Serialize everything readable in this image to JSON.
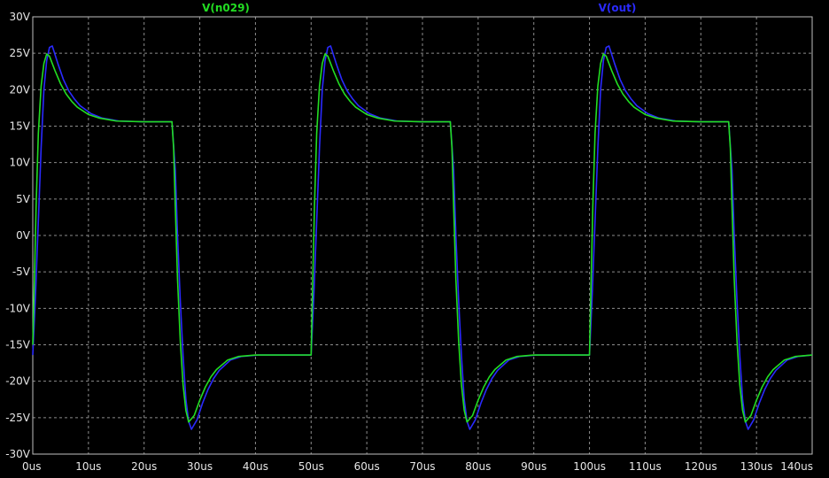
{
  "chart_data": {
    "type": "line",
    "title": "",
    "xlabel": "",
    "ylabel": "",
    "xlim": [
      0,
      140
    ],
    "ylim": [
      -30,
      30
    ],
    "grid": true,
    "legend_placement": "top",
    "x_ticks": [
      0,
      10,
      20,
      30,
      40,
      50,
      60,
      70,
      80,
      90,
      100,
      110,
      120,
      130,
      140
    ],
    "x_tick_labels": [
      "0us",
      "10us",
      "20us",
      "30us",
      "40us",
      "50us",
      "60us",
      "70us",
      "80us",
      "90us",
      "100us",
      "110us",
      "120us",
      "130us",
      "140us"
    ],
    "y_ticks": [
      -30,
      -25,
      -20,
      -15,
      -10,
      -5,
      0,
      5,
      10,
      15,
      20,
      25,
      30
    ],
    "y_tick_labels": [
      "-30V",
      "-25V",
      "-20V",
      "-15V",
      "-10V",
      "-5V",
      "0V",
      "5V",
      "10V",
      "15V",
      "20V",
      "25V",
      "30V"
    ],
    "colors": {
      "background": "#000000",
      "grid": "#8c8c8c",
      "axis": "#bfbfbf",
      "tick_text": "#e6e6e6"
    },
    "series": [
      {
        "name": "V(n029)",
        "color": "#22dd22",
        "x": [
          0,
          0.3,
          0.6,
          1,
          1.5,
          2,
          2.5,
          3,
          4,
          5,
          6,
          7,
          8,
          10,
          12,
          15,
          20,
          25,
          25.3,
          25.6,
          26,
          26.5,
          27,
          27.5,
          28,
          29,
          30,
          31,
          32,
          33,
          35,
          37,
          40,
          45,
          50,
          50.3,
          50.6,
          51,
          51.5,
          52,
          52.5,
          53,
          54,
          55,
          56,
          57,
          58,
          60,
          62,
          65,
          70,
          75,
          75.3,
          75.6,
          76,
          76.5,
          77,
          77.5,
          78,
          79,
          80,
          81,
          82,
          83,
          85,
          87,
          90,
          95,
          100,
          100.3,
          100.6,
          101,
          101.5,
          102,
          102.5,
          103,
          104,
          105,
          106,
          107,
          108,
          110,
          112,
          115,
          120,
          125,
          125.3,
          125.6,
          126,
          126.5,
          127,
          127.5,
          128,
          129,
          130,
          131,
          132,
          133,
          135,
          137,
          140
        ],
        "values": [
          -15,
          -6,
          4,
          14,
          20.5,
          23.6,
          24.9,
          24.6,
          22.6,
          20.8,
          19.4,
          18.4,
          17.6,
          16.6,
          16.1,
          15.7,
          15.6,
          15.6,
          12,
          4,
          -6,
          -14.5,
          -20.5,
          -24,
          -25.6,
          -24.7,
          -22.6,
          -20.8,
          -19.4,
          -18.4,
          -17.1,
          -16.6,
          -16.4,
          -16.4,
          -16.4,
          -6,
          4,
          14,
          20.5,
          23.6,
          24.9,
          24.6,
          22.6,
          20.8,
          19.4,
          18.4,
          17.6,
          16.6,
          16.1,
          15.7,
          15.6,
          15.6,
          12,
          4,
          -6,
          -14.5,
          -20.5,
          -24,
          -25.6,
          -24.7,
          -22.6,
          -20.8,
          -19.4,
          -18.4,
          -17.1,
          -16.6,
          -16.4,
          -16.4,
          -16.4,
          -6,
          4,
          14,
          20.5,
          23.6,
          24.9,
          24.6,
          22.6,
          20.8,
          19.4,
          18.4,
          17.6,
          16.6,
          16.1,
          15.7,
          15.6,
          15.6,
          12,
          4,
          -6,
          -14.5,
          -20.5,
          -24,
          -25.6,
          -24.7,
          -22.6,
          -20.8,
          -19.4,
          -18.4,
          -17.1,
          -16.6,
          -16.4
        ]
      },
      {
        "name": "V(out)",
        "color": "#2a2aff",
        "x": [
          0,
          0.5,
          1,
          1.5,
          2,
          2.5,
          3,
          3.5,
          4.5,
          5.5,
          6.5,
          7.5,
          8.5,
          10.5,
          12.5,
          15.5,
          20,
          25,
          25.6,
          26,
          26.5,
          27,
          27.5,
          28,
          28.5,
          29.5,
          30.5,
          31.5,
          32.5,
          33.5,
          35.5,
          37.5,
          40.5,
          45,
          50,
          50.5,
          51,
          51.5,
          52,
          52.5,
          53,
          53.5,
          54.5,
          55.5,
          56.5,
          57.5,
          58.5,
          60.5,
          62.5,
          65.5,
          70,
          75,
          75.6,
          76,
          76.5,
          77,
          77.5,
          78,
          78.5,
          79.5,
          80.5,
          81.5,
          82.5,
          83.5,
          85.5,
          87.5,
          90.5,
          95,
          100,
          100.5,
          101,
          101.5,
          102,
          102.5,
          103,
          103.5,
          104.5,
          105.5,
          106.5,
          107.5,
          108.5,
          110.5,
          112.5,
          115.5,
          120,
          125,
          125.6,
          126,
          126.5,
          127,
          127.5,
          128,
          128.5,
          129.5,
          130.5,
          131.5,
          132.5,
          133.5,
          135.5,
          137.5,
          140
        ],
        "values": [
          -16.4,
          -8,
          2,
          12,
          20,
          24,
          25.8,
          26,
          23.6,
          21.4,
          19.8,
          18.7,
          17.8,
          16.7,
          16.1,
          15.7,
          15.6,
          15.6,
          9,
          0,
          -9,
          -16.5,
          -22.5,
          -25.5,
          -26.6,
          -25.3,
          -23,
          -21.1,
          -19.6,
          -18.5,
          -17.1,
          -16.6,
          -16.4,
          -16.4,
          -16.4,
          -8,
          2,
          12,
          20,
          24,
          25.8,
          26,
          23.6,
          21.4,
          19.8,
          18.7,
          17.8,
          16.7,
          16.1,
          15.7,
          15.6,
          15.6,
          9,
          0,
          -9,
          -16.5,
          -22.5,
          -25.5,
          -26.6,
          -25.3,
          -23,
          -21.1,
          -19.6,
          -18.5,
          -17.1,
          -16.6,
          -16.4,
          -16.4,
          -16.4,
          -8,
          2,
          12,
          20,
          24,
          25.8,
          26,
          23.6,
          21.4,
          19.8,
          18.7,
          17.8,
          16.7,
          16.1,
          15.7,
          15.6,
          15.6,
          9,
          0,
          -9,
          -16.5,
          -22.5,
          -25.5,
          -26.6,
          -25.3,
          -23,
          -21.1,
          -19.6,
          -18.5,
          -17.1,
          -16.6,
          -16.4
        ]
      }
    ]
  }
}
